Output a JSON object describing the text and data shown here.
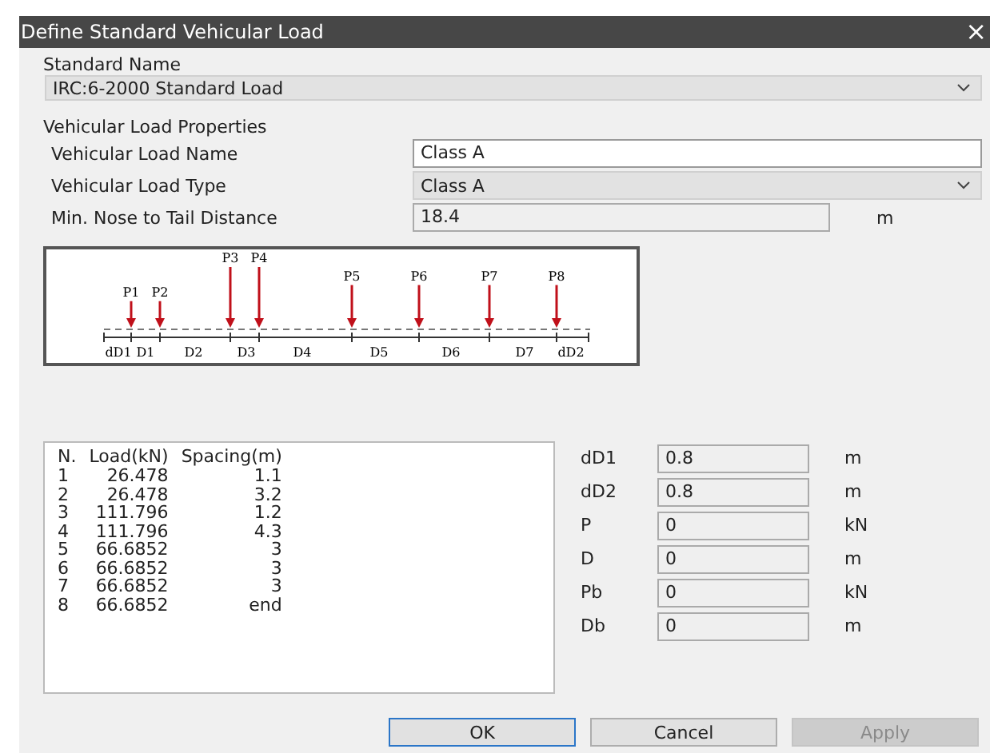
{
  "window": {
    "title": "Define Standard Vehicular Load",
    "close": "×"
  },
  "standard_name": {
    "label": "Standard Name",
    "value": "IRC:6-2000 Standard Load"
  },
  "properties": {
    "title": "Vehicular Load Properties",
    "fields": [
      {
        "kind": "text",
        "label": "Vehicular Load Name",
        "value": "Class A"
      },
      {
        "kind": "combo",
        "label": "Vehicular Load Type",
        "value": "Class A"
      },
      {
        "kind": "readonly",
        "label": "Min. Nose to Tail Distance",
        "value": "18.4",
        "unit": "m"
      }
    ]
  },
  "diagram": {
    "loads": [
      "P1",
      "P2",
      "P3",
      "P4",
      "P5",
      "P6",
      "P7",
      "P8"
    ],
    "spans": [
      "dD1",
      "D1",
      "D2",
      "D3",
      "D4",
      "D5",
      "D6",
      "D7",
      "dD2"
    ]
  },
  "table": {
    "columns": [
      "N.",
      "Load(kN)",
      "Spacing(m)"
    ],
    "rows": [
      [
        "1",
        "26.478",
        "1.1"
      ],
      [
        "2",
        "26.478",
        "3.2"
      ],
      [
        "3",
        "111.796",
        "1.2"
      ],
      [
        "4",
        "111.796",
        "4.3"
      ],
      [
        "5",
        "66.6852",
        "3"
      ],
      [
        "6",
        "66.6852",
        "3"
      ],
      [
        "7",
        "66.6852",
        "3"
      ],
      [
        "8",
        "66.6852",
        "end"
      ]
    ]
  },
  "params": [
    {
      "label": "dD1",
      "value": "0.8",
      "unit": "m"
    },
    {
      "label": "dD2",
      "value": "0.8",
      "unit": "m"
    },
    {
      "label": "P",
      "value": "0",
      "unit": "kN"
    },
    {
      "label": "D",
      "value": "0",
      "unit": "m"
    },
    {
      "label": "Pb",
      "value": "0",
      "unit": "kN"
    },
    {
      "label": "Db",
      "value": "0",
      "unit": "m"
    }
  ],
  "buttons": [
    {
      "label": "OK",
      "default": true,
      "disabled": false
    },
    {
      "label": "Cancel",
      "default": false,
      "disabled": false
    },
    {
      "label": "Apply",
      "default": false,
      "disabled": true
    }
  ]
}
